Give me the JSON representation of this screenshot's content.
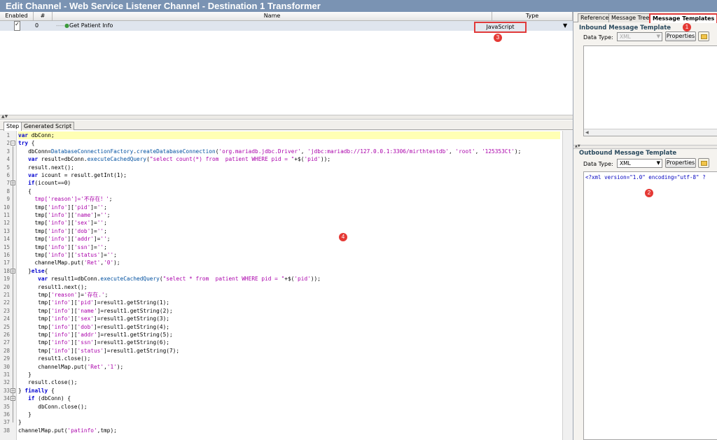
{
  "window": {
    "title": "Edit Channel - Web Service Listener Channel - Destination 1 Transformer"
  },
  "table": {
    "columns": [
      "Enabled",
      "#",
      "Name",
      "Type"
    ],
    "row": {
      "enabled": true,
      "number": "0",
      "name": "Get Patient Info",
      "type": "JavaScript"
    }
  },
  "editor_tabs": [
    "Step",
    "Generated Script"
  ],
  "code": {
    "line_numbers": [
      "1",
      "2",
      "3",
      "4",
      "5",
      "6",
      "7",
      "8",
      "9",
      "10",
      "11",
      "12",
      "13",
      "14",
      "15",
      "16",
      "17",
      "18",
      "19",
      "20",
      "21",
      "22",
      "23",
      "24",
      "25",
      "26",
      "27",
      "28",
      "29",
      "30",
      "31",
      "32",
      "33",
      "34",
      "35",
      "36",
      "37",
      "38"
    ]
  },
  "right_panel": {
    "tabs": [
      "Reference",
      "Message Trees",
      "Message Templates"
    ],
    "inbound": {
      "title": "Inbound Message Template",
      "data_type_label": "Data Type:",
      "data_type": "XML",
      "properties_label": "Properties"
    },
    "outbound": {
      "title": "Outbound Message Template",
      "data_type_label": "Data Type:",
      "data_type": "XML",
      "properties_label": "Properties",
      "content": "<?xml version=\"1.0\" encoding=\"utf-8\" ?"
    }
  },
  "annotations": [
    "1",
    "2",
    "3",
    "4"
  ],
  "colors": {
    "title_bar": "#7a93b3",
    "selected_row": "#dfe5ee",
    "highlight_line": "#ffffb4",
    "annotation": "#e53935",
    "keyword": "#0000d0",
    "string": "#aa00aa"
  }
}
